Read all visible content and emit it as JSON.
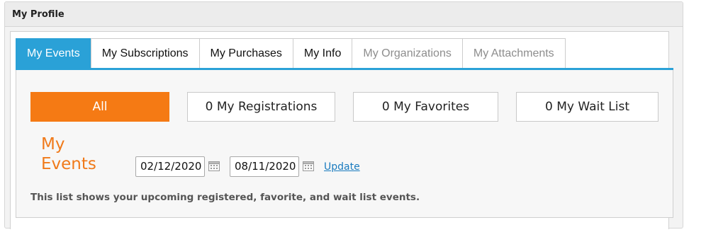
{
  "panel": {
    "title": "My Profile"
  },
  "tabs": [
    {
      "label": "My Events",
      "state": "active"
    },
    {
      "label": "My Subscriptions",
      "state": "normal"
    },
    {
      "label": "My Purchases",
      "state": "normal"
    },
    {
      "label": "My Info",
      "state": "normal"
    },
    {
      "label": "My Organizations",
      "state": "disabled"
    },
    {
      "label": "My Attachments",
      "state": "disabled"
    }
  ],
  "filters": {
    "all": "All",
    "registrations": "0  My Registrations",
    "favorites": "0  My Favorites",
    "wait_list": "0  My Wait List"
  },
  "events": {
    "heading": "My Events",
    "start_date": "02/12/2020",
    "end_date": "08/11/2020",
    "calendar_icon": "calendar-icon",
    "update_label": "Update",
    "note": "This list shows your upcoming registered, favorite, and wait list events."
  },
  "colors": {
    "tab_active": "#2aa1d7",
    "filter_active": "#f57a14",
    "heading": "#f07a1a",
    "link": "#1a7bbf"
  }
}
